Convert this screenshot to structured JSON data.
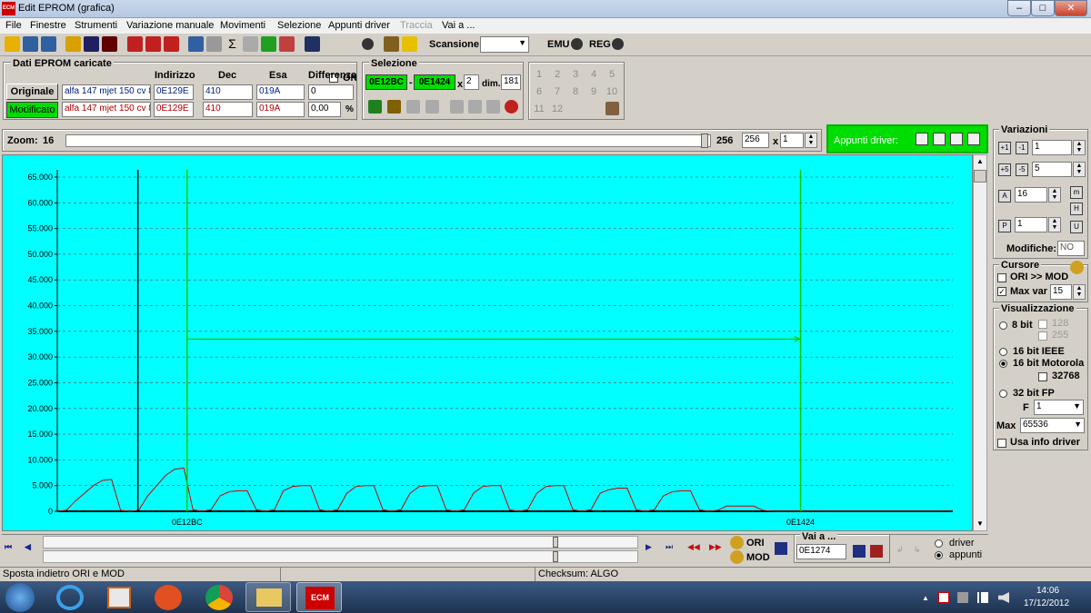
{
  "window": {
    "title": "Edit EPROM (grafica)",
    "icon_text": "ECM",
    "min": "–",
    "max": "□",
    "close": "✕"
  },
  "menu": [
    "File",
    "Finestre",
    "Strumenti",
    "Variazione manuale",
    "Movimenti",
    "Selezione",
    "Appunti driver",
    "Traccia",
    "Vai a ..."
  ],
  "toolbar": {
    "on_label": "ON",
    "scansione_label": "Scansione",
    "emu_label": "EMU",
    "reg_label": "REG"
  },
  "dati": {
    "title": "Dati EPROM caricate",
    "headers": {
      "indirizzo": "Indirizzo",
      "dec": "Dec",
      "esa": "Esa",
      "diff": "Differenza"
    },
    "originale": {
      "label": "Originale",
      "name": "alfa 147 mjet 150 cv 8!",
      "addr": "0E129E",
      "dec": "410",
      "esa": "019A",
      "diff": "0"
    },
    "modificato": {
      "label": "Modificato",
      "name": "alfa 147 mjet 150 cv 8!",
      "addr": "0E129E",
      "dec": "410",
      "esa": "019A",
      "diff": "0,00",
      "pct": "%"
    }
  },
  "selezione": {
    "title": "Selezione",
    "from": "0E12BC",
    "dash": "-",
    "to": "0E1424",
    "x_label": "x",
    "x_val": "2",
    "dim_label": "dim.",
    "dim_val": "181"
  },
  "numkeys": [
    "1",
    "2",
    "3",
    "4",
    "5",
    "6",
    "7",
    "8",
    "9",
    "10",
    "11",
    "12"
  ],
  "zoom": {
    "label": "Zoom:",
    "min": "16",
    "max": "256",
    "val": "256",
    "x_label": "x",
    "x_val": "1"
  },
  "appunti": {
    "label": "Appunti driver:"
  },
  "chart_data": {
    "type": "line",
    "ylim": [
      0,
      65000
    ],
    "yticks": [
      "65.000",
      "60.000",
      "55.000",
      "50.000",
      "45.000",
      "40.000",
      "35.000",
      "30.000",
      "25.000",
      "20.000",
      "15.000",
      "10.000",
      "5.000",
      "0"
    ],
    "xlabels": [
      "0E12BC",
      "0E1424"
    ],
    "series": [
      {
        "color": "#cc0000",
        "values": [
          0,
          200,
          2000,
          3500,
          5000,
          6000,
          6200,
          200,
          0,
          200,
          3000,
          5000,
          7000,
          8200,
          8400,
          300,
          0,
          300,
          3000,
          3800,
          4000,
          4000,
          300,
          0,
          300,
          4000,
          4800,
          5000,
          5000,
          300,
          0,
          300,
          3500,
          4800,
          5000,
          5000,
          300,
          0,
          300,
          3500,
          4800,
          5000,
          5000,
          300,
          0,
          300,
          3500,
          4800,
          5000,
          5000,
          300,
          0,
          300,
          3500,
          4800,
          5000,
          5000,
          300,
          0,
          300,
          3500,
          4200,
          4500,
          4500,
          300,
          0,
          300,
          3000,
          3800,
          4000,
          4000,
          300,
          0,
          200,
          1000,
          1000,
          1000,
          1000,
          200,
          0,
          0,
          0,
          0,
          0,
          0,
          0,
          0,
          0,
          0,
          0,
          0,
          0,
          0,
          0,
          0,
          0,
          0,
          0,
          0,
          0
        ]
      }
    ],
    "markers": {
      "cursor_black": 0.09,
      "sel_start": 0.145,
      "sel_end": 0.83,
      "sel_arrow_y": 33500
    },
    "grid": true
  },
  "variazioni": {
    "title": "Variazioni",
    "v1": "1",
    "v2": "5",
    "v3": "16",
    "v4": "1",
    "modifiche_label": "Modifiche:",
    "modifiche_val": "NO"
  },
  "cursore": {
    "title": "Cursore",
    "ori_mod": "ORI >> MOD",
    "max_var": "Max var",
    "max_var_val": "15"
  },
  "visualizzazione": {
    "title": "Visualizzazione",
    "b8": "8 bit",
    "v128": "128",
    "v255": "255",
    "ieee": "16 bit IEEE",
    "motorola": "16 bit Motorola",
    "v32768": "32768",
    "fp": "32 bit FP",
    "f_label": "F",
    "f_val": "1",
    "max_label": "Max",
    "max_val": "65536",
    "usa_info": "Usa info driver"
  },
  "bottom": {
    "ori": "ORI",
    "mod": "MOD",
    "vai_label": "Vai a ...",
    "vai_val": "0E1274",
    "driver": "driver",
    "appunti": "appunti"
  },
  "status": {
    "left": "Sposta indietro ORI e MOD",
    "checksum": "Checksum: ALGO"
  },
  "taskbar": {
    "time": "14:06",
    "date": "17/12/2012",
    "ecm": "ECM"
  },
  "colors": {
    "chart_bg": "#00ffff",
    "line": "#cc0000",
    "selection": "#00cc00",
    "accent_green": "#00dd00"
  }
}
